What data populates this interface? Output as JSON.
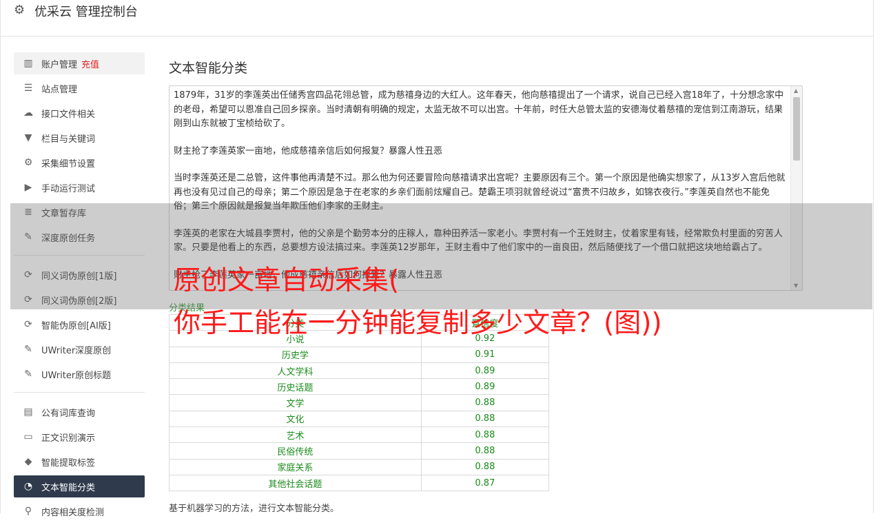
{
  "header": {
    "title": "优采云 管理控制台"
  },
  "sidebar": {
    "items": [
      {
        "label": "账户管理",
        "extra": "充值",
        "icon": "bar-chart-icon"
      },
      {
        "label": "站点管理",
        "icon": "server-icon"
      },
      {
        "label": "接口文件相关",
        "icon": "cloud-upload-icon"
      },
      {
        "label": "栏目与关键词",
        "icon": "filter-icon"
      },
      {
        "label": "采集细节设置",
        "icon": "gears-icon"
      },
      {
        "label": "手动运行测试",
        "icon": "play-icon"
      },
      {
        "label": "文章暂存库",
        "icon": "database-icon"
      },
      {
        "label": "深度原创任务",
        "icon": "edit-icon"
      },
      {
        "label": "同义词伪原创[1版]",
        "icon": "refresh-icon"
      },
      {
        "label": "同义词伪原创[2版]",
        "icon": "refresh-icon"
      },
      {
        "label": "智能伪原创[AI版]",
        "icon": "refresh-icon"
      },
      {
        "label": "UWriter深度原创",
        "icon": "edit-icon"
      },
      {
        "label": "UWriter原创标题",
        "icon": "edit-icon"
      },
      {
        "label": "公有词库查询",
        "icon": "book-icon"
      },
      {
        "label": "正文识别演示",
        "icon": "monitor-icon"
      },
      {
        "label": "智能提取标签",
        "icon": "tag-icon"
      },
      {
        "label": "文本智能分类",
        "icon": "pie-chart-icon"
      },
      {
        "label": "内容相关度检测",
        "icon": "search-icon"
      }
    ]
  },
  "main": {
    "title": "文本智能分类",
    "paragraphs": [
      "1879年，31岁的李莲英出任储秀宫四品花翎总管，成为慈禧身边的大红人。这年春天，他向慈禧提出了一个请求，说自己已经入宫18年了，十分想念家中的老母，希望可以恩准自己回乡探亲。当时清朝有明确的规定，太监无故不可以出宫。十年前，时任大总管太监的安德海仗着慈禧的宠信到江南游玩，结果刚到山东就被丁宝桢给砍了。",
      "财主抢了李莲英家一亩地，他成慈禧亲信后如何报复？暴露人性丑恶",
      "当时李莲英还是二总管，这件事他再清楚不过。那么他为何还要冒险向慈禧请求出宫呢？主要原因有三个。第一个原因是他确实想家了，从13岁入宫后他就再也没有见过自己的母亲；第二个原因是急于在老家的乡亲们面前炫耀自己。楚霸王项羽就曾经说过“富贵不归故乡，如锦衣夜行。”李莲英自然也不能免俗；第三个原因就是报复当年欺压他们李家的王财主。",
      "李莲英的老家在大城县李贾村，他的父亲是个勤劳本分的庄稼人，靠种田养活一家老小。李贾村有一个王姓财主，仗着家里有钱，经常欺负村里面的穷苦人家。只要是他看上的东西，总要想方设法搞过来。李莲英12岁那年，王财主看中了他们家中的一亩良田，然后随便找了一个借口就把这块地给霸占了。",
      "财主抢了李莲英家一亩地，他成慈禧亲信后如何报复？暴露人性丑恶"
    ],
    "result_label": "分类结果",
    "table": {
      "headers": [
        "分类",
        "置信度"
      ],
      "rows": [
        [
          "小说",
          "0.92"
        ],
        [
          "历史学",
          "0.91"
        ],
        [
          "人文学科",
          "0.89"
        ],
        [
          "历史话题",
          "0.89"
        ],
        [
          "文学",
          "0.88"
        ],
        [
          "文化",
          "0.88"
        ],
        [
          "艺术",
          "0.88"
        ],
        [
          "民俗传统",
          "0.88"
        ],
        [
          "家庭关系",
          "0.88"
        ],
        [
          "其他社会话题",
          "0.87"
        ]
      ]
    },
    "footnote": "基于机器学习的方法，进行文本智能分类。"
  },
  "overlay": {
    "line1": "原创文章自动采集(",
    "line2": "你手工能在一分钟能复制多少文章？(图))"
  }
}
